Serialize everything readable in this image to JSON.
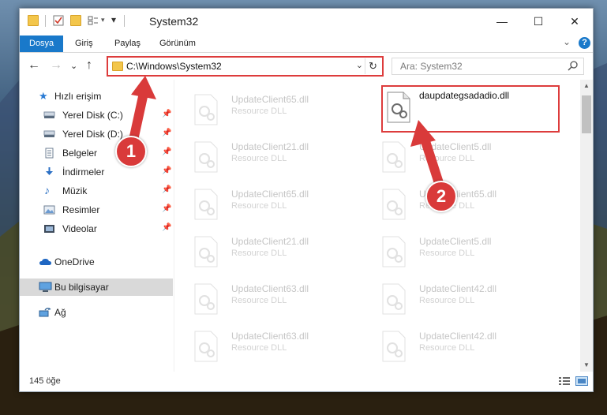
{
  "window": {
    "title": "System32"
  },
  "ribbon": {
    "tabs": [
      "Dosya",
      "Giriş",
      "Paylaş",
      "Görünüm"
    ],
    "help_label": "?"
  },
  "nav": {
    "address": "C:\\Windows\\System32",
    "search_placeholder": "Ara: System32"
  },
  "sidebar": {
    "quick_access": "Hızlı erişim",
    "items": [
      {
        "label": "Yerel Disk (C:)",
        "icon": "drive-icon"
      },
      {
        "label": "Yerel Disk (D:)",
        "icon": "drive-icon"
      },
      {
        "label": "Belgeler",
        "icon": "documents-icon"
      },
      {
        "label": "İndirmeler",
        "icon": "download-icon"
      },
      {
        "label": "Müzik",
        "icon": "music-icon"
      },
      {
        "label": "Resimler",
        "icon": "pictures-icon"
      },
      {
        "label": "Videolar",
        "icon": "videos-icon"
      }
    ],
    "onedrive": "OneDrive",
    "this_pc": "Bu bilgisayar",
    "network": "Ağ"
  },
  "files": [
    {
      "name": "UpdateClient65.dll",
      "type": "Resource DLL"
    },
    {
      "name": "daupdategsadadio.dll",
      "type": ""
    },
    {
      "name": "UpdateClient21.dll",
      "type": "Resource DLL"
    },
    {
      "name": "UpdateClient5.dll",
      "type": "Resource DLL"
    },
    {
      "name": "UpdateClient65.dll",
      "type": "Resource DLL"
    },
    {
      "name": "UpdateClient65.dll",
      "type": "Resource DLL"
    },
    {
      "name": "UpdateClient21.dll",
      "type": "Resource DLL"
    },
    {
      "name": "UpdateClient5.dll",
      "type": "Resource DLL"
    },
    {
      "name": "UpdateClient63.dll",
      "type": "Resource DLL"
    },
    {
      "name": "UpdateClient42.dll",
      "type": "Resource DLL"
    },
    {
      "name": "UpdateClient63.dll",
      "type": "Resource DLL"
    },
    {
      "name": "UpdateClient42.dll",
      "type": "Resource DLL"
    }
  ],
  "status": {
    "item_count": "145 öğe"
  },
  "callouts": [
    "1",
    "2"
  ],
  "colors": {
    "accent": "#1979ca",
    "highlight": "#dd3c3c"
  }
}
